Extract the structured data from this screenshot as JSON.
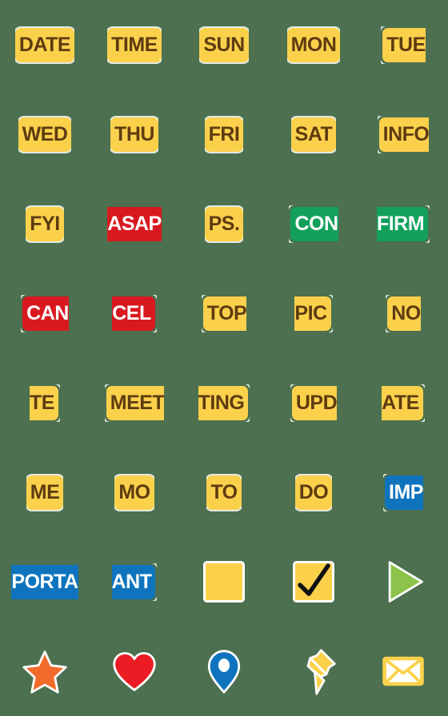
{
  "meta": {
    "background_color": "#4c7050",
    "grid_columns": 5,
    "grid_rows": 8,
    "total_items": 40
  },
  "palette": {
    "yellow": "#fbd14b",
    "red": "#d81920",
    "green": "#12a05c",
    "blue": "#0f74bd",
    "orange": "#f26b2a",
    "heart_red": "#eb1c24",
    "leaf_green": "#8cc34a",
    "text_brown": "#5e3b10",
    "text_white": "#ffffff",
    "outline_white": "#ffffff",
    "check_black": "#111111"
  },
  "items": [
    {
      "id": 1,
      "kind": "label",
      "text": "DATE",
      "color": "yellow",
      "clip": "none"
    },
    {
      "id": 2,
      "kind": "label",
      "text": "TIME",
      "color": "yellow",
      "clip": "none"
    },
    {
      "id": 3,
      "kind": "label",
      "text": "SUN",
      "color": "yellow",
      "clip": "none"
    },
    {
      "id": 4,
      "kind": "label",
      "text": "MON",
      "color": "yellow",
      "clip": "none"
    },
    {
      "id": 5,
      "kind": "label",
      "text": "TUE",
      "color": "yellow",
      "clip": "right"
    },
    {
      "id": 6,
      "kind": "label",
      "text": "WED",
      "color": "yellow",
      "clip": "none"
    },
    {
      "id": 7,
      "kind": "label",
      "text": "THU",
      "color": "yellow",
      "clip": "none"
    },
    {
      "id": 8,
      "kind": "label",
      "text": "FRI",
      "color": "yellow",
      "clip": "none"
    },
    {
      "id": 9,
      "kind": "label",
      "text": "SAT",
      "color": "yellow",
      "clip": "none"
    },
    {
      "id": 10,
      "kind": "label",
      "text": "INFO",
      "color": "yellow",
      "clip": "right"
    },
    {
      "id": 11,
      "kind": "label",
      "text": "FYI",
      "color": "yellow",
      "clip": "none"
    },
    {
      "id": 12,
      "kind": "label",
      "text": "ASAP",
      "color": "red",
      "clip": "both"
    },
    {
      "id": 13,
      "kind": "label",
      "text": "PS.",
      "color": "yellow",
      "clip": "none"
    },
    {
      "id": 14,
      "kind": "label",
      "text": "CON",
      "color": "green",
      "clip": "right"
    },
    {
      "id": 15,
      "kind": "label",
      "text": "FIRM",
      "color": "green",
      "clip": "left"
    },
    {
      "id": 16,
      "kind": "label",
      "text": "CAN",
      "color": "red",
      "clip": "right"
    },
    {
      "id": 17,
      "kind": "label",
      "text": "CEL",
      "color": "red",
      "clip": "left"
    },
    {
      "id": 18,
      "kind": "label",
      "text": "TOP",
      "color": "yellow",
      "clip": "right"
    },
    {
      "id": 19,
      "kind": "label",
      "text": "PIC",
      "color": "yellow",
      "clip": "left"
    },
    {
      "id": 20,
      "kind": "label",
      "text": "NO",
      "color": "yellow",
      "clip": "right"
    },
    {
      "id": 21,
      "kind": "label",
      "text": "TE",
      "color": "yellow",
      "clip": "left"
    },
    {
      "id": 22,
      "kind": "label",
      "text": "MEET",
      "color": "yellow",
      "clip": "right"
    },
    {
      "id": 23,
      "kind": "label",
      "text": "TING",
      "color": "yellow",
      "clip": "left"
    },
    {
      "id": 24,
      "kind": "label",
      "text": "UPD",
      "color": "yellow",
      "clip": "right"
    },
    {
      "id": 25,
      "kind": "label",
      "text": "ATE",
      "color": "yellow",
      "clip": "left"
    },
    {
      "id": 26,
      "kind": "label",
      "text": "ME",
      "color": "yellow",
      "clip": "none"
    },
    {
      "id": 27,
      "kind": "label",
      "text": "MO",
      "color": "yellow",
      "clip": "none"
    },
    {
      "id": 28,
      "kind": "label",
      "text": "TO",
      "color": "yellow",
      "clip": "none"
    },
    {
      "id": 29,
      "kind": "label",
      "text": "DO",
      "color": "yellow",
      "clip": "none"
    },
    {
      "id": 30,
      "kind": "label",
      "text": "IMP",
      "color": "blue",
      "clip": "right"
    },
    {
      "id": 31,
      "kind": "label",
      "text": "PORTA",
      "color": "blue",
      "clip": "both"
    },
    {
      "id": 32,
      "kind": "label",
      "text": "ANT",
      "color": "blue",
      "clip": "left"
    },
    {
      "id": 33,
      "kind": "shape",
      "shape": "blank-square",
      "text": ""
    },
    {
      "id": 34,
      "kind": "shape",
      "shape": "check-square",
      "text": ""
    },
    {
      "id": 35,
      "kind": "shape",
      "shape": "play-triangle",
      "text": ""
    },
    {
      "id": 36,
      "kind": "shape",
      "shape": "star",
      "text": ""
    },
    {
      "id": 37,
      "kind": "shape",
      "shape": "heart",
      "text": ""
    },
    {
      "id": 38,
      "kind": "shape",
      "shape": "map-pin",
      "text": ""
    },
    {
      "id": 39,
      "kind": "shape",
      "shape": "pushpin",
      "text": ""
    },
    {
      "id": 40,
      "kind": "shape",
      "shape": "envelope",
      "text": ""
    }
  ]
}
